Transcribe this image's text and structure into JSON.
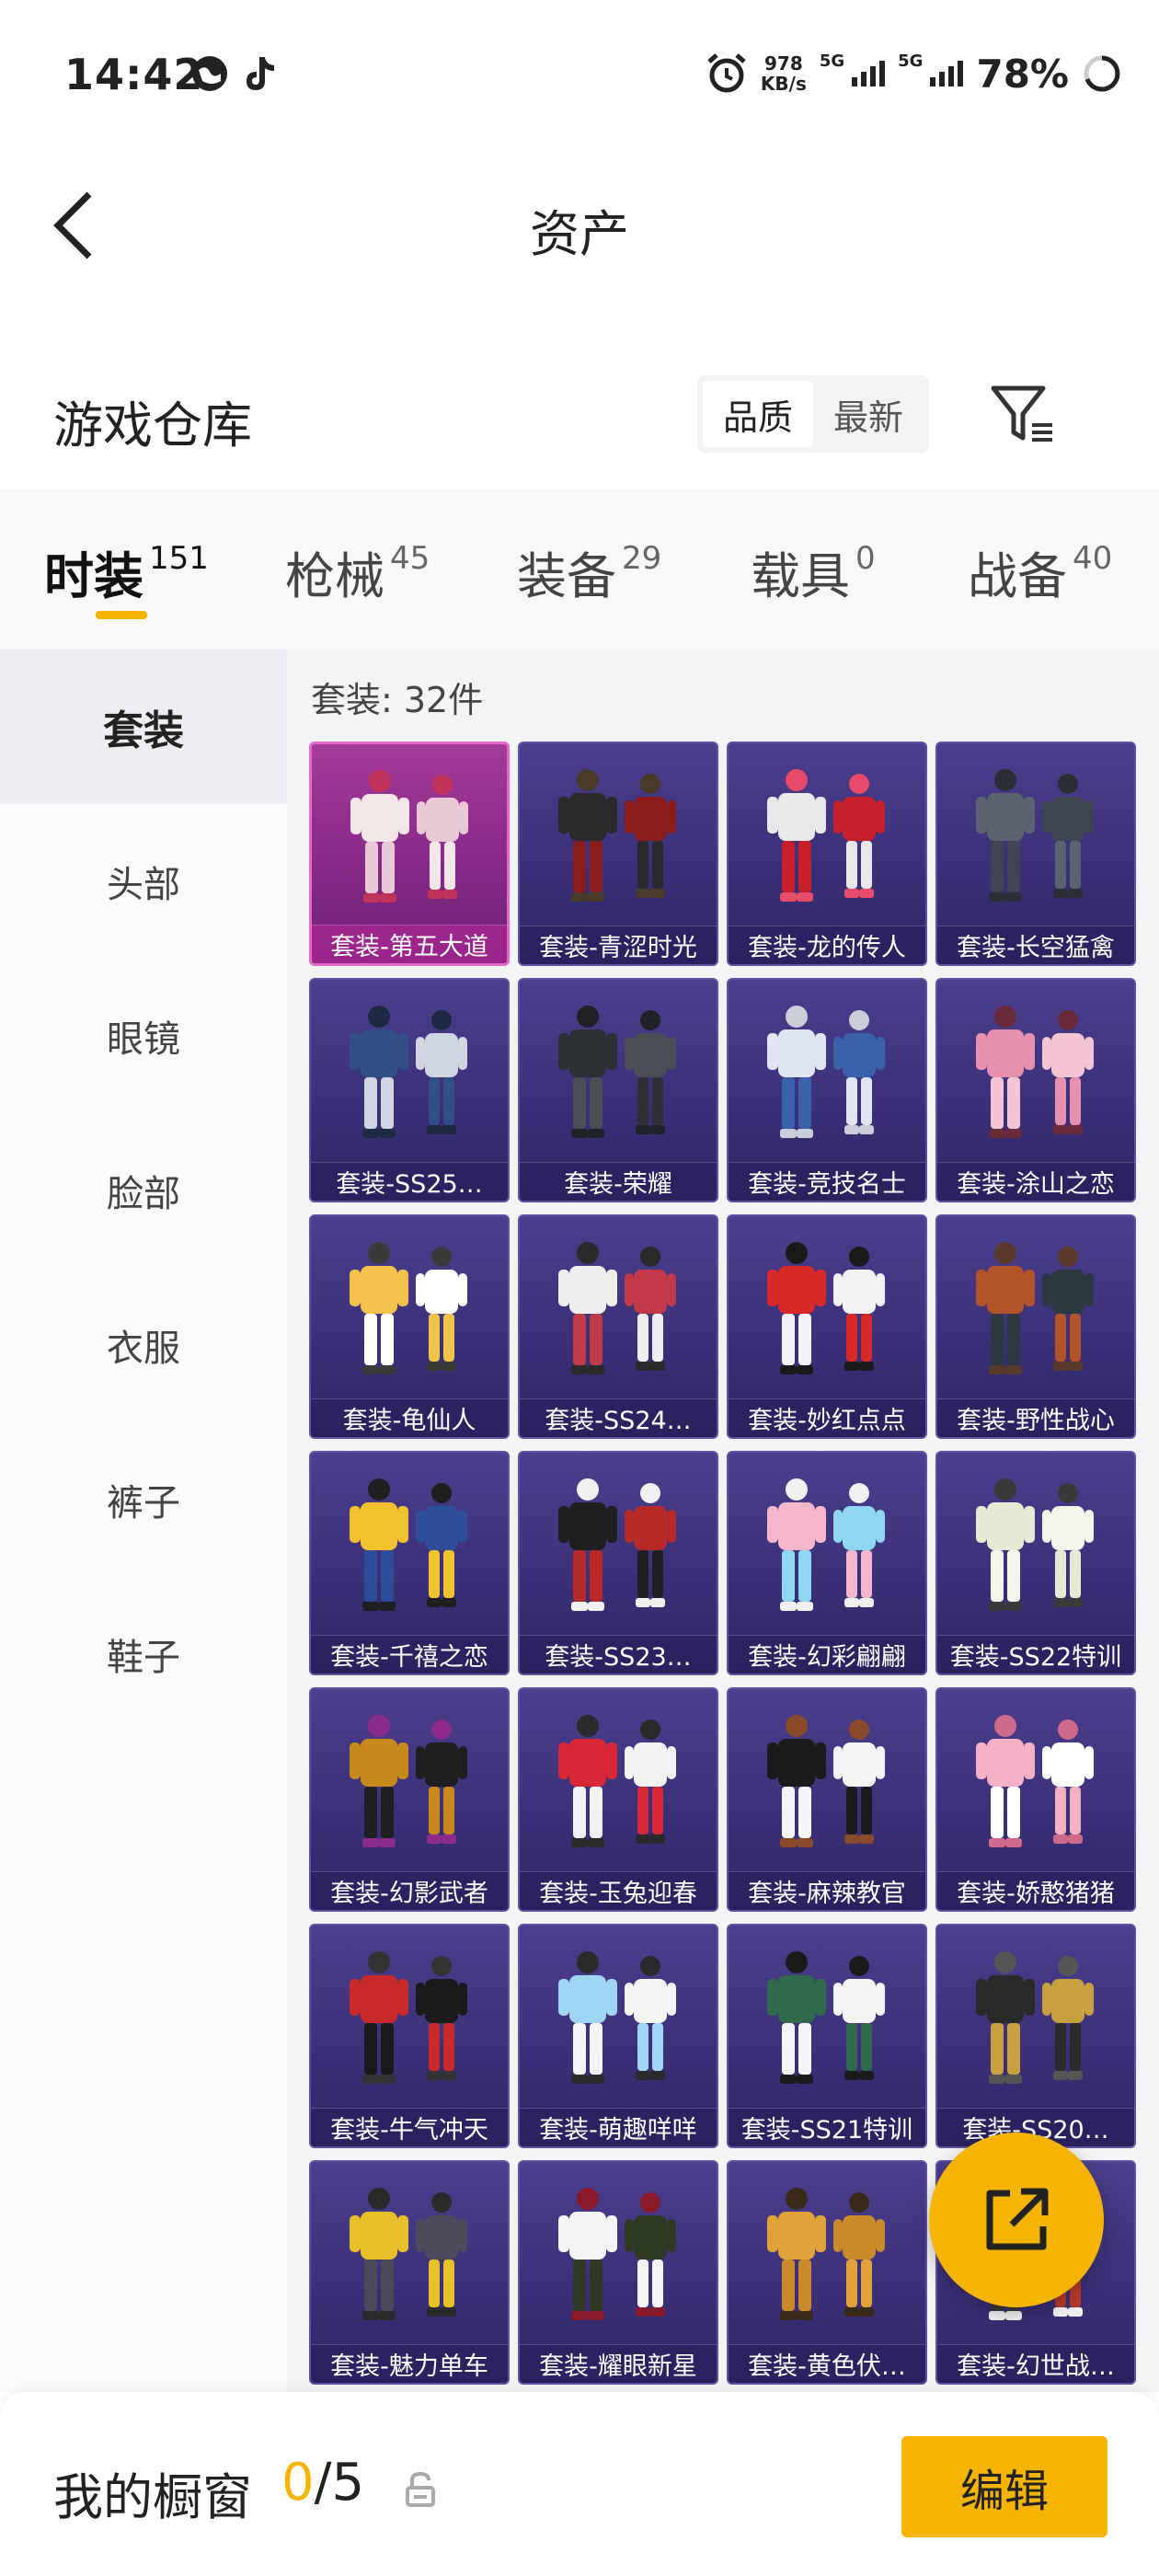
{
  "status_bar": {
    "time": "14:42",
    "speed_value": "978",
    "speed_unit": "KB/s",
    "network_1": "5G",
    "network_2": "5G",
    "battery": "78%"
  },
  "header": {
    "title": "资产"
  },
  "warehouse": {
    "title": "游戏仓库",
    "sort_quality": "品质",
    "sort_newest": "最新"
  },
  "tabs": [
    {
      "label": "时装",
      "count": "151"
    },
    {
      "label": "枪械",
      "count": "45"
    },
    {
      "label": "装备",
      "count": "29"
    },
    {
      "label": "载具",
      "count": "0"
    },
    {
      "label": "战备",
      "count": "40"
    }
  ],
  "sidebar": {
    "items": [
      "套装",
      "头部",
      "眼镜",
      "脸部",
      "衣服",
      "裤子",
      "鞋子"
    ]
  },
  "content": {
    "count_label": "套装: 32件",
    "items": [
      "套装-第五大道",
      "套装-青涩时光",
      "套装-龙的传人",
      "套装-长空猛禽",
      "套装-SS25…",
      "套装-荣耀",
      "套装-竞技名士",
      "套装-涂山之恋",
      "套装-龟仙人",
      "套装-SS24…",
      "套装-妙红点点",
      "套装-野性战心",
      "套装-千禧之恋",
      "套装-SS23…",
      "套装-幻彩翩翩",
      "套装-SS22特训",
      "套装-幻影武者",
      "套装-玉兔迎春",
      "套装-麻辣教官",
      "套装-娇憨猪猪",
      "套装-牛气冲天",
      "套装-萌趣咩咩",
      "套装-SS21特训",
      "套装-SS20…",
      "套装-魅力单车",
      "套装-耀眼新星",
      "套装-黄色伏…",
      "套装-幻世战…"
    ]
  },
  "bottom_bar": {
    "label": "我的橱窗",
    "current": "0",
    "separator": "/",
    "total": "5",
    "edit_label": "编辑"
  },
  "colors": {
    "accent": "#f5b400",
    "card_bg": "#3a2f77",
    "card_special_bg": "#8a2a8a"
  }
}
